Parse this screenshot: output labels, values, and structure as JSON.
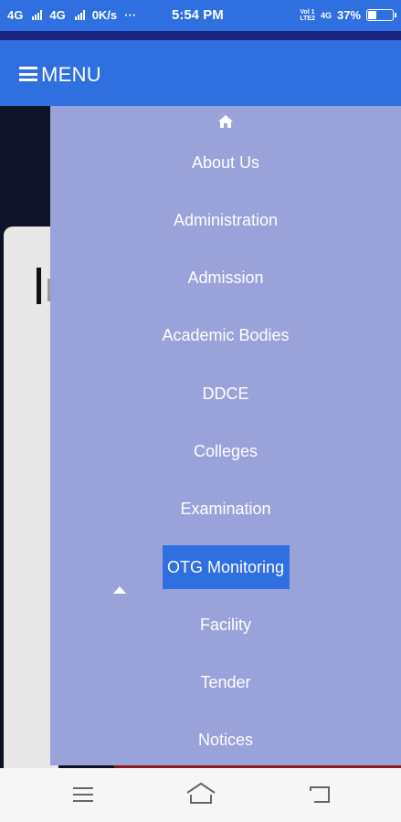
{
  "status_bar": {
    "net1": "4G",
    "net2": "4G",
    "speed": "0K/s",
    "dots": "···",
    "time": "5:54 PM",
    "volte_top": "Vol 1",
    "volte_bottom": "LTE2",
    "net3": "4G",
    "battery": "37%",
    "battery_level": 0.37
  },
  "header": {
    "menu_label": "MENU"
  },
  "drawer": {
    "items": [
      {
        "label": "About Us"
      },
      {
        "label": "Administration"
      },
      {
        "label": "Admission"
      },
      {
        "label": "Academic Bodies"
      },
      {
        "label": "DDCE"
      },
      {
        "label": "Colleges"
      },
      {
        "label": "Examination"
      },
      {
        "label": "OTG Monitoring",
        "active": true
      },
      {
        "label": "Facility"
      },
      {
        "label": "Tender"
      },
      {
        "label": "Notices"
      }
    ]
  },
  "icons": {
    "home": "home-icon",
    "menu": "hamburger-icon",
    "scroll_up": "caret-up-icon",
    "nav_menu": "menu-icon",
    "nav_home": "home-outline-icon",
    "nav_back": "back-icon"
  }
}
